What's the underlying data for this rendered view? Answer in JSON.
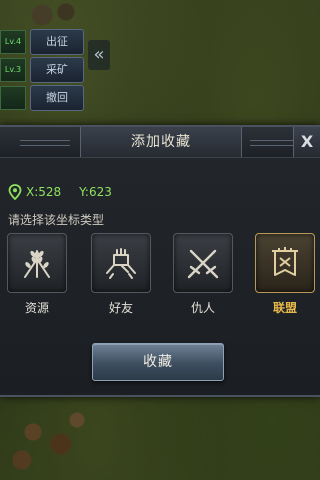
{
  "side_menu": {
    "items": [
      {
        "tag": "Lv.4",
        "label": "出征"
      },
      {
        "tag": "Lv.3",
        "label": "采矿"
      },
      {
        "tag": "",
        "label": "撤回"
      }
    ],
    "collapse_icon": "double-chevron-left-icon"
  },
  "dialog": {
    "title": "添加收藏",
    "close_label": "X",
    "coords": {
      "x_label": "X:528",
      "y_label": "Y:623"
    },
    "prompt": "请选择该坐标类型",
    "types": [
      {
        "label": "资源",
        "icon": "wheat-icon",
        "selected": false
      },
      {
        "label": "好友",
        "icon": "handshake-icon",
        "selected": false
      },
      {
        "label": "仇人",
        "icon": "crossed-swords-icon",
        "selected": false
      },
      {
        "label": "联盟",
        "icon": "alliance-banner-icon",
        "selected": true
      }
    ],
    "confirm_label": "收藏"
  },
  "colors": {
    "coord_green": "#8ee25e",
    "selected_gold": "#e7b84a"
  }
}
